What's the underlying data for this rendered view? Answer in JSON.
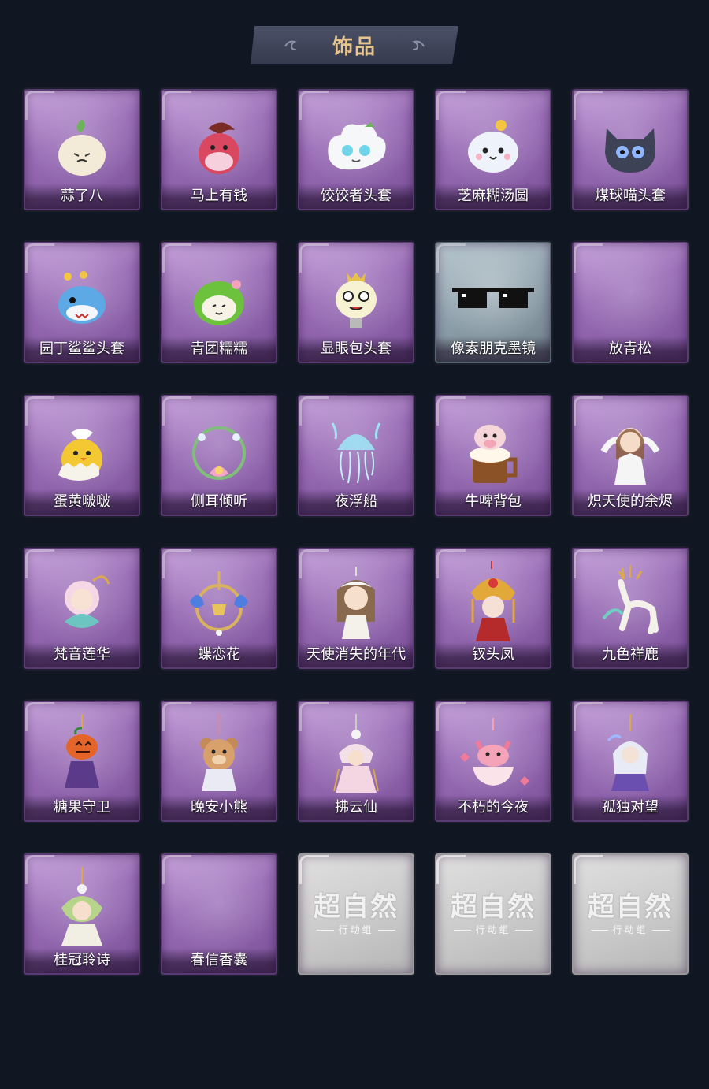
{
  "header": {
    "title": "饰品"
  },
  "items": [
    {
      "label": "蒜了八",
      "icon": "garlic-icon",
      "rarity": "purple"
    },
    {
      "label": "马上有钱",
      "icon": "horse-head-icon",
      "rarity": "purple"
    },
    {
      "label": "饺饺者头套",
      "icon": "dumpling-head-icon",
      "rarity": "purple"
    },
    {
      "label": "芝麻糊汤圆",
      "icon": "rice-ball-icon",
      "rarity": "purple"
    },
    {
      "label": "煤球喵头套",
      "icon": "black-cat-head-icon",
      "rarity": "purple"
    },
    {
      "label": "园丁鲨鲨头套",
      "icon": "shark-head-icon",
      "rarity": "purple"
    },
    {
      "label": "青团糯糯",
      "icon": "green-dumpling-icon",
      "rarity": "purple"
    },
    {
      "label": "显眼包头套",
      "icon": "lightbulb-head-icon",
      "rarity": "purple"
    },
    {
      "label": "像素朋克墨镜",
      "icon": "pixel-sunglasses-icon",
      "rarity": "grey"
    },
    {
      "label": "放青松",
      "icon": "",
      "rarity": "purple"
    },
    {
      "label": "蛋黄啵啵",
      "icon": "chick-egg-icon",
      "rarity": "purple"
    },
    {
      "label": "侧耳倾听",
      "icon": "flower-wreath-icon",
      "rarity": "purple"
    },
    {
      "label": "夜浮船",
      "icon": "jellyfish-icon",
      "rarity": "purple"
    },
    {
      "label": "牛啤背包",
      "icon": "cow-beer-mug-icon",
      "rarity": "purple"
    },
    {
      "label": "炽天使的余烬",
      "icon": "angel-figure-icon",
      "rarity": "purple"
    },
    {
      "label": "梵音莲华",
      "icon": "lotus-figure-icon",
      "rarity": "purple"
    },
    {
      "label": "蝶恋花",
      "icon": "butterfly-bell-icon",
      "rarity": "purple"
    },
    {
      "label": "天使消失的年代",
      "icon": "angel-girl-icon",
      "rarity": "purple"
    },
    {
      "label": "钗头凤",
      "icon": "phoenix-crown-icon",
      "rarity": "purple"
    },
    {
      "label": "九色祥鹿",
      "icon": "deer-charm-icon",
      "rarity": "purple"
    },
    {
      "label": "糖果守卫",
      "icon": "pumpkin-charm-icon",
      "rarity": "purple"
    },
    {
      "label": "晚安小熊",
      "icon": "teddy-bear-charm-icon",
      "rarity": "purple"
    },
    {
      "label": "拂云仙",
      "icon": "fairy-charm-icon",
      "rarity": "purple"
    },
    {
      "label": "不朽的今夜",
      "icon": "pink-fox-charm-icon",
      "rarity": "purple"
    },
    {
      "label": "孤独对望",
      "icon": "moon-figure-charm-icon",
      "rarity": "purple"
    },
    {
      "label": "桂冠聆诗",
      "icon": "laurel-figure-charm-icon",
      "rarity": "purple"
    },
    {
      "label": "春信香囊",
      "icon": "",
      "rarity": "purple"
    },
    {
      "label": "",
      "icon": "locked-placeholder-icon",
      "rarity": "locked",
      "logo": "超自然",
      "sub": "行动组"
    },
    {
      "label": "",
      "icon": "locked-placeholder-icon",
      "rarity": "locked",
      "logo": "超自然",
      "sub": "行动组"
    },
    {
      "label": "",
      "icon": "locked-placeholder-icon",
      "rarity": "locked",
      "logo": "超自然",
      "sub": "行动组"
    }
  ]
}
